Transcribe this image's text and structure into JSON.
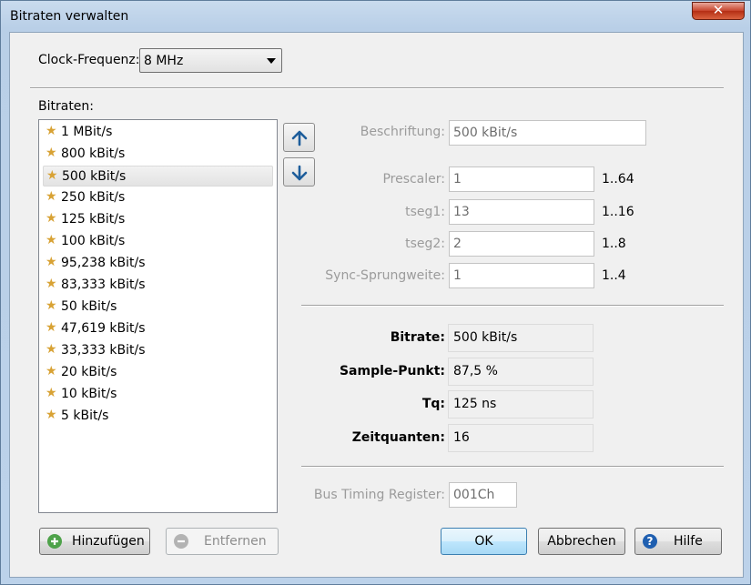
{
  "window": {
    "title": "Bitraten verwalten",
    "close_glyph": "✕"
  },
  "clock": {
    "label": "Clock-Frequenz:",
    "value": "8 MHz"
  },
  "bitrates": {
    "label": "Bitraten:",
    "selected": "500 kBit/s",
    "items": [
      "1 MBit/s",
      "800 kBit/s",
      "500 kBit/s",
      "250 kBit/s",
      "125 kBit/s",
      "100 kBit/s",
      "95,238 kBit/s",
      "83,333 kBit/s",
      "50 kBit/s",
      "47,619 kBit/s",
      "33,333 kBit/s",
      "20 kBit/s",
      "10 kBit/s",
      "5 kBit/s"
    ]
  },
  "move": {
    "up_icon": "arrow-up-icon",
    "down_icon": "arrow-down-icon"
  },
  "params": {
    "beschriftung": {
      "label": "Beschriftung:",
      "value": "500 kBit/s"
    },
    "prescaler": {
      "label": "Prescaler:",
      "value": "1",
      "range": "1..64"
    },
    "tseg1": {
      "label": "tseg1:",
      "value": "13",
      "range": "1..16"
    },
    "tseg2": {
      "label": "tseg2:",
      "value": "2",
      "range": "1..8"
    },
    "sjw": {
      "label": "Sync-Sprungweite:",
      "value": "1",
      "range": "1..4"
    }
  },
  "results": {
    "bitrate": {
      "label": "Bitrate:",
      "value": "500 kBit/s"
    },
    "sample": {
      "label": "Sample-Punkt:",
      "value": "87,5 %"
    },
    "tq": {
      "label": "Tq:",
      "value": "125 ns"
    },
    "quanta": {
      "label": "Zeitquanten:",
      "value": "16"
    }
  },
  "btr": {
    "label": "Bus Timing Register:",
    "value": "001Ch"
  },
  "buttons": {
    "add": "Hinzufügen",
    "remove": "Entfernen",
    "ok": "OK",
    "cancel": "Abbrechen",
    "help": "Hilfe"
  },
  "colors": {
    "star": "#d8a234",
    "add_icon": "#4ea24a",
    "help_icon": "#1f5fb0"
  }
}
